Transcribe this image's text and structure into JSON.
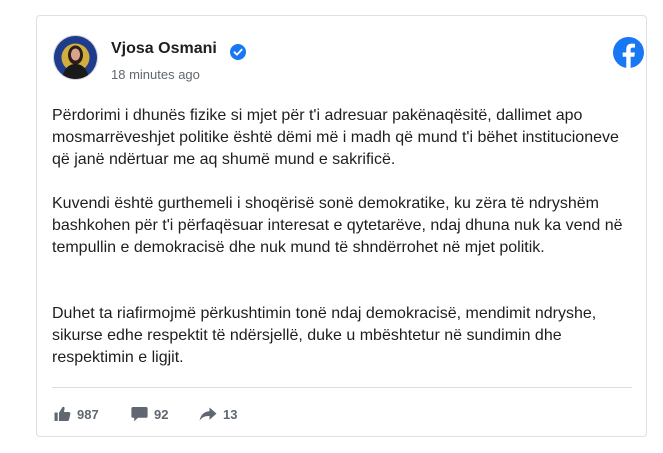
{
  "post": {
    "author": "Vjosa Osmani",
    "time": "18 minutes ago",
    "paragraphs": [
      "Përdorimi i dhunës fizike si mjet për t'i adresuar pakënaqësitë, dallimet apo mosmarrëveshjet politike është dëmi më i madh që mund t'i bëhet institucioneve që janë ndërtuar me aq shumë mund e sakrificë.",
      "Kuvendi është gurthemeli i shoqërisë sonë demokratike, ku zëra të ndryshëm bashkohen për t'i përfaqësuar interesat e qytetarëve, ndaj dhuna nuk ka vend në tempullin e demokracisë dhe nuk mund të shndërrohet në mjet politik.",
      "Duhet ta riafirmojmë përkushtimin tonë ndaj demokracisë, mendimit ndryshe, sikurse edhe respektit të ndërsjellë, duke u mbështetur në sundimin dhe respektimin e ligjit."
    ]
  },
  "stats": {
    "likes": "987",
    "comments": "92",
    "shares": "13"
  },
  "icons": {
    "avatar": "profile-photo",
    "verified": "verified-badge-icon",
    "brand": "facebook-logo-icon",
    "like": "thumbs-up-icon",
    "comment": "comment-bubble-icon",
    "share": "share-arrow-icon"
  },
  "colors": {
    "verified": "#1877f2",
    "facebook": "#1877f2",
    "stat_icon": "#606770",
    "text": "#1c1e21",
    "muted": "#606770"
  }
}
